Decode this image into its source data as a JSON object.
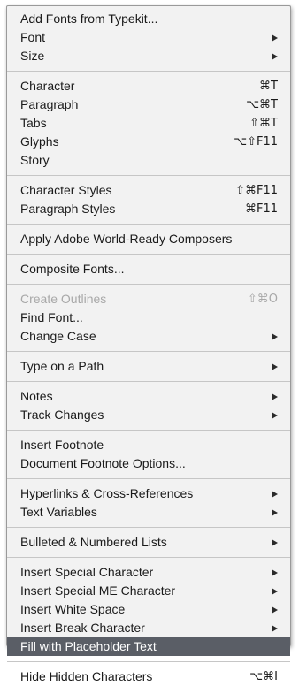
{
  "menu": {
    "groups": [
      [
        {
          "label": "Add Fonts from Typekit...",
          "shortcut": "",
          "submenu": false
        },
        {
          "label": "Font",
          "shortcut": "",
          "submenu": true
        },
        {
          "label": "Size",
          "shortcut": "",
          "submenu": true
        }
      ],
      [
        {
          "label": "Character",
          "shortcut": "⌘T",
          "submenu": false
        },
        {
          "label": "Paragraph",
          "shortcut": "⌥⌘T",
          "submenu": false
        },
        {
          "label": "Tabs",
          "shortcut": "⇧⌘T",
          "submenu": false
        },
        {
          "label": "Glyphs",
          "shortcut": "⌥⇧F11",
          "submenu": false
        },
        {
          "label": "Story",
          "shortcut": "",
          "submenu": false
        }
      ],
      [
        {
          "label": "Character Styles",
          "shortcut": "⇧⌘F11",
          "submenu": false
        },
        {
          "label": "Paragraph Styles",
          "shortcut": "⌘F11",
          "submenu": false
        }
      ],
      [
        {
          "label": "Apply Adobe World-Ready Composers",
          "shortcut": "",
          "submenu": false
        }
      ],
      [
        {
          "label": "Composite Fonts...",
          "shortcut": "",
          "submenu": false
        }
      ],
      [
        {
          "label": "Create Outlines",
          "shortcut": "⇧⌘O",
          "submenu": false,
          "disabled": true
        },
        {
          "label": "Find Font...",
          "shortcut": "",
          "submenu": false
        },
        {
          "label": "Change Case",
          "shortcut": "",
          "submenu": true
        }
      ],
      [
        {
          "label": "Type on a Path",
          "shortcut": "",
          "submenu": true
        }
      ],
      [
        {
          "label": "Notes",
          "shortcut": "",
          "submenu": true
        },
        {
          "label": "Track Changes",
          "shortcut": "",
          "submenu": true
        }
      ],
      [
        {
          "label": "Insert Footnote",
          "shortcut": "",
          "submenu": false
        },
        {
          "label": "Document Footnote Options...",
          "shortcut": "",
          "submenu": false
        }
      ],
      [
        {
          "label": "Hyperlinks & Cross-References",
          "shortcut": "",
          "submenu": true
        },
        {
          "label": "Text Variables",
          "shortcut": "",
          "submenu": true
        }
      ],
      [
        {
          "label": "Bulleted & Numbered Lists",
          "shortcut": "",
          "submenu": true
        }
      ],
      [
        {
          "label": "Insert Special Character",
          "shortcut": "",
          "submenu": true
        },
        {
          "label": "Insert Special ME Character",
          "shortcut": "",
          "submenu": true
        },
        {
          "label": "Insert White Space",
          "shortcut": "",
          "submenu": true
        },
        {
          "label": "Insert Break Character",
          "shortcut": "",
          "submenu": true
        },
        {
          "label": "Fill with Placeholder Text",
          "shortcut": "",
          "submenu": false,
          "highlighted": true
        }
      ],
      [
        {
          "label": "Hide Hidden Characters",
          "shortcut": "⌥⌘I",
          "submenu": false
        }
      ]
    ]
  },
  "colors": {
    "menu_background": "#f2f2f2",
    "highlight": "#5a5e66",
    "disabled_text": "#a8a8a8",
    "separator": "#c6c6c6"
  }
}
